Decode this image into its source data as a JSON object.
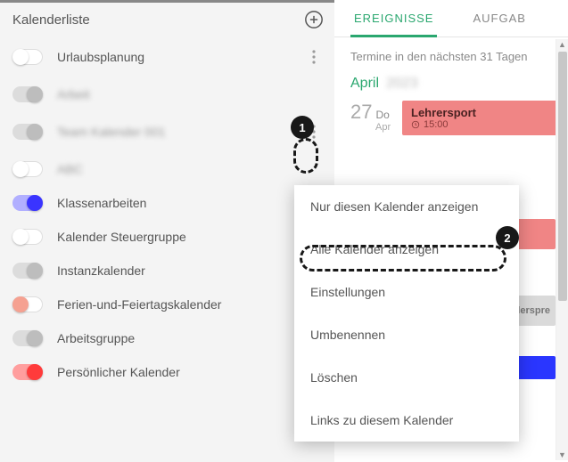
{
  "sidebar": {
    "title": "Kalenderliste",
    "items": [
      {
        "name": "Urlaubsplanung",
        "on": false,
        "knob_color": "#ffffff",
        "track": "#ffffff",
        "blurred": false,
        "show_dots": true
      },
      {
        "name": "Arbeit",
        "on": true,
        "knob_color": "#bdbdbd",
        "track": "#dcdcdc",
        "blurred": true,
        "show_dots": false
      },
      {
        "name": "Team Kalender 001",
        "on": true,
        "knob_color": "#bdbdbd",
        "track": "#dcdcdc",
        "blurred": true,
        "show_dots": true
      },
      {
        "name": "ABC",
        "on": false,
        "knob_color": "#ffffff",
        "track": "#ffffff",
        "blurred": true,
        "show_dots": false
      },
      {
        "name": "Klassenarbeiten",
        "on": true,
        "knob_color": "#3a34ff",
        "track": "#b1afff",
        "blurred": false,
        "show_dots": false
      },
      {
        "name": "Kalender Steuergruppe",
        "on": false,
        "knob_color": "#ffffff",
        "track": "#ffffff",
        "blurred": false,
        "show_dots": false
      },
      {
        "name": "Instanzkalender",
        "on": true,
        "knob_color": "#bdbdbd",
        "track": "#dcdcdc",
        "blurred": false,
        "show_dots": false
      },
      {
        "name": "Ferien-und-Feiertagskalender",
        "on": false,
        "knob_color": "#f5a191",
        "track": "#ffffff",
        "blurred": false,
        "show_dots": false
      },
      {
        "name": "Arbeitsgruppe",
        "on": true,
        "knob_color": "#bdbdbd",
        "track": "#dcdcdc",
        "blurred": false,
        "show_dots": false
      },
      {
        "name": "Persönlicher Kalender",
        "on": true,
        "knob_color": "#ff3b3b",
        "track": "#ff9e9e",
        "blurred": false,
        "show_dots": false
      }
    ]
  },
  "tabs": {
    "events": "EREIGNISSE",
    "tasks": "AUFGAB"
  },
  "subheader": "Termine in den nächsten 31 Tagen",
  "month": "April",
  "event": {
    "day_num": "27",
    "weekday": "Do",
    "mon": "Apr",
    "title": "Lehrersport",
    "time": "15:00"
  },
  "stub_label": "Schülerspre",
  "context_menu": {
    "items": {
      "only_this": "Nur diesen Kalender anzeigen",
      "all": "Alle Kalender anzeigen",
      "settings": "Einstellungen",
      "rename": "Umbenennen",
      "delete": "Löschen",
      "links": "Links zu diesem Kalender"
    }
  },
  "annotations": {
    "badge1": "1",
    "badge2": "2"
  }
}
